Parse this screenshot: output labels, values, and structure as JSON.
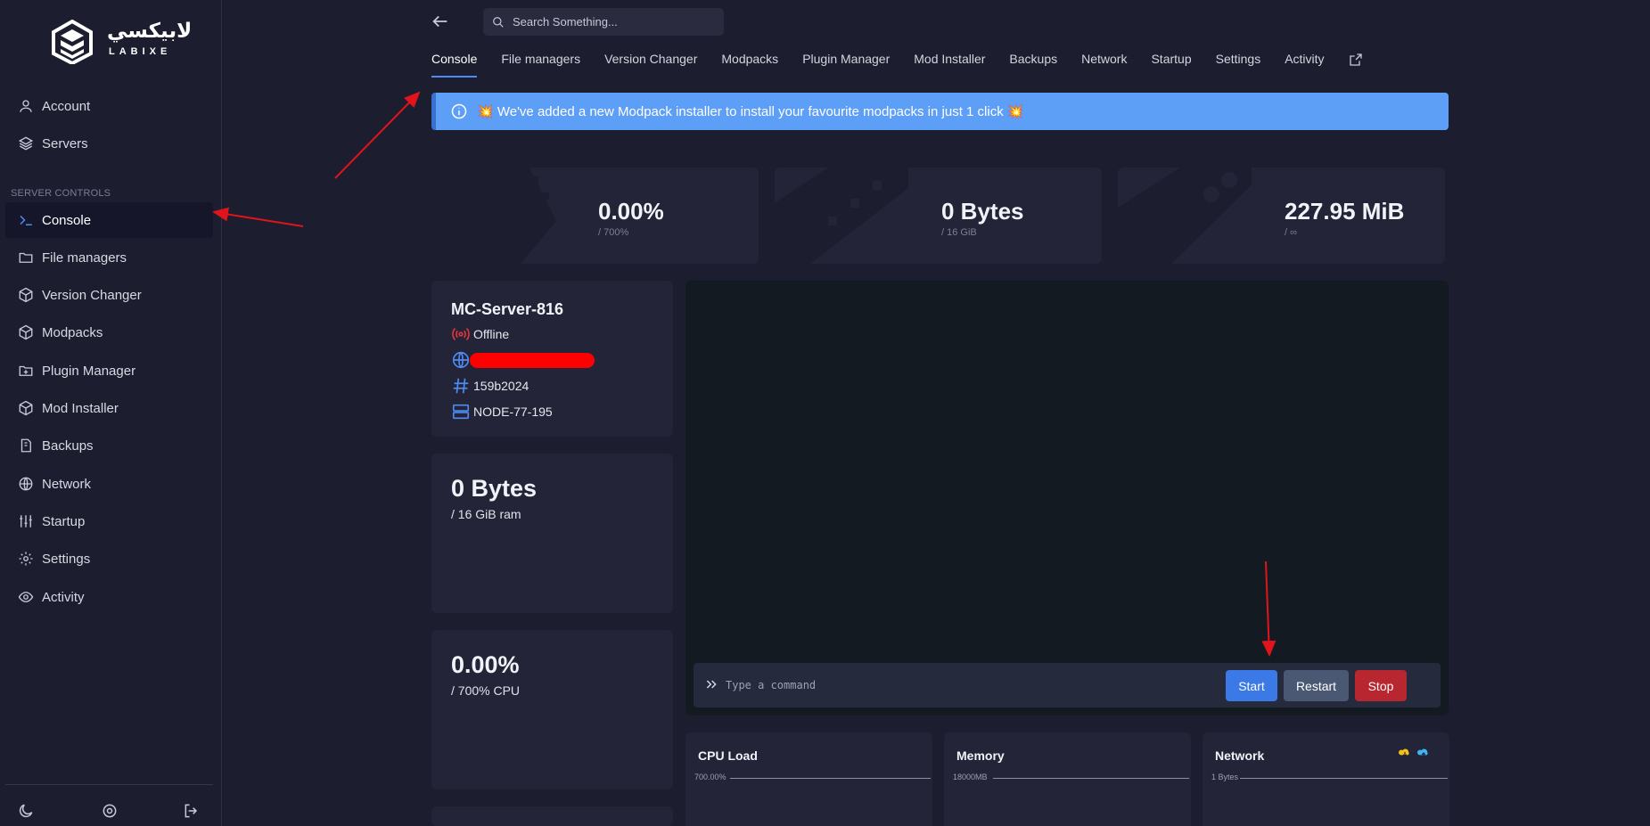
{
  "brand": {
    "arabic": "لابيكسي",
    "latin": "LABIXE"
  },
  "sidebar": {
    "top_items": [
      {
        "label": "Account",
        "icon": "user-icon"
      },
      {
        "label": "Servers",
        "icon": "layers-icon"
      }
    ],
    "section_label": "SERVER CONTROLS",
    "items": [
      {
        "label": "Console",
        "icon": "terminal-icon",
        "active": true
      },
      {
        "label": "File managers",
        "icon": "folder-icon"
      },
      {
        "label": "Version Changer",
        "icon": "box-icon"
      },
      {
        "label": "Modpacks",
        "icon": "box-icon"
      },
      {
        "label": "Plugin Manager",
        "icon": "folder-plus-icon"
      },
      {
        "label": "Mod Installer",
        "icon": "box-icon"
      },
      {
        "label": "Backups",
        "icon": "archive-icon"
      },
      {
        "label": "Network",
        "icon": "globe-icon"
      },
      {
        "label": "Startup",
        "icon": "sliders-icon"
      },
      {
        "label": "Settings",
        "icon": "gear-icon"
      },
      {
        "label": "Activity",
        "icon": "eye-icon"
      }
    ],
    "bottom_icons": [
      "moon-icon",
      "gear-icon",
      "logout-icon"
    ]
  },
  "search": {
    "placeholder": "Search Something..."
  },
  "tabs": [
    "Console",
    "File managers",
    "Version Changer",
    "Modpacks",
    "Plugin Manager",
    "Mod Installer",
    "Backups",
    "Network",
    "Startup",
    "Settings",
    "Activity"
  ],
  "banner": {
    "text": "💥 We've added a new Modpack installer to install your favourite modpacks in just 1 click 💥"
  },
  "stats": [
    {
      "value": "0.00%",
      "sub": "/ 700%"
    },
    {
      "value": "0 Bytes",
      "sub": "/ 16 GiB"
    },
    {
      "value": "227.95 MiB",
      "sub": "/ ∞"
    }
  ],
  "server": {
    "name": "MC-Server-816",
    "status": "Offline",
    "id": "159b2024",
    "node": "NODE-77-195"
  },
  "memory_card": {
    "value": "0 Bytes",
    "sub": "/ 16 GiB ram"
  },
  "cpu_card": {
    "value": "0.00%",
    "sub": "/ 700% CPU"
  },
  "console": {
    "placeholder": "Type a command",
    "start": "Start",
    "restart": "Restart",
    "stop": "Stop"
  },
  "graphs": [
    {
      "title": "CPU Load",
      "label": "700.00%"
    },
    {
      "title": "Memory",
      "label": "18000MB"
    },
    {
      "title": "Network",
      "label": "1 Bytes"
    }
  ],
  "colors": {
    "accent": "#4f8bf3",
    "banner": "#5d9ef7",
    "danger": "#b8262f",
    "annotation": "#e3131b"
  }
}
